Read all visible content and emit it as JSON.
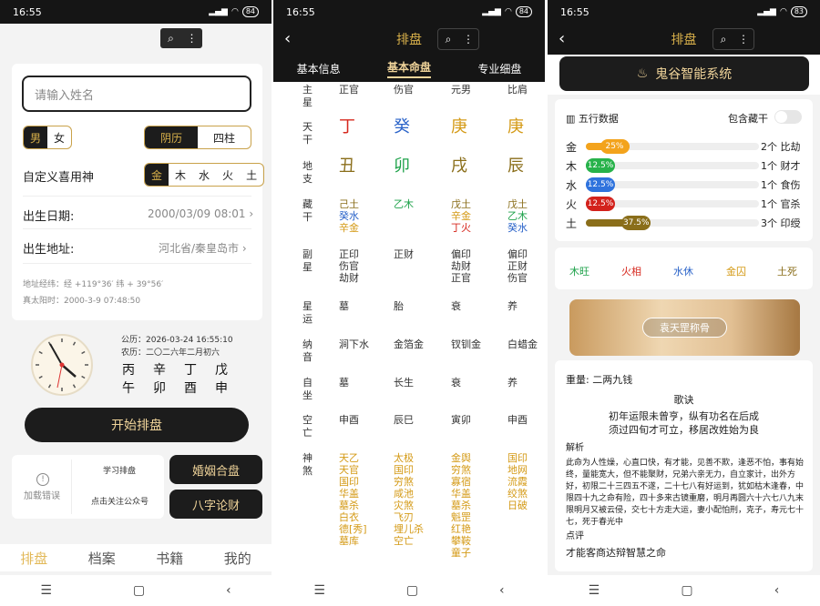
{
  "status": {
    "time": "16:55",
    "battery1": "84",
    "battery2": "84",
    "battery3": "83"
  },
  "p1": {
    "name_placeholder": "请输入姓名",
    "gender": [
      "男",
      "女"
    ],
    "calendar": [
      "阴历",
      "四柱"
    ],
    "xiyong_label": "自定义喜用神",
    "xiyong": [
      "金",
      "木",
      "水",
      "火",
      "土"
    ],
    "birth_date_label": "出生日期:",
    "birth_date": "2000/03/09 08:01",
    "birth_place_label": "出生地址:",
    "birth_place": "河北省/秦皇岛市",
    "coords": "地址经纬：经 +119°36′ 纬 + 39°56′",
    "solar_time": "真太阳时：2000-3-9 07:48:50",
    "gongli": "公历：2026-03-24 16:55:10",
    "nongli": "农历：二〇二六年二月初六",
    "bazi_top": [
      "丙",
      "辛",
      "丁",
      "戊"
    ],
    "bazi_bottom": [
      "午",
      "卯",
      "酉",
      "申"
    ],
    "start_btn": "开始排盘",
    "load_error": "加载错误",
    "learn": "学习排盘",
    "follow": "点击关注公众号",
    "marriage": "婚姻合盘",
    "bazi_talk": "八字论财",
    "nav": [
      "排盘",
      "档案",
      "书籍",
      "我的"
    ]
  },
  "p2": {
    "title": "排盘",
    "tabs": [
      "基本信息",
      "基本命盘",
      "专业细盘"
    ],
    "rows": [
      {
        "label": "主星",
        "cells": [
          [
            "正官"
          ],
          [
            "伤官"
          ],
          [
            "元男"
          ],
          [
            "比肩"
          ]
        ]
      },
      {
        "label": "天干",
        "cells": [
          [
            "丁"
          ],
          [
            "癸"
          ],
          [
            "庚"
          ],
          [
            "庚"
          ]
        ]
      },
      {
        "label": "地支",
        "cells": [
          [
            "丑"
          ],
          [
            "卯"
          ],
          [
            "戌"
          ],
          [
            "辰"
          ]
        ]
      },
      {
        "label": "藏干",
        "cells": [
          [
            "己土",
            "癸水",
            "辛金"
          ],
          [
            "乙木"
          ],
          [
            "戊土",
            "辛金",
            "丁火"
          ],
          [
            "戊土",
            "乙木",
            "癸水"
          ]
        ]
      },
      {
        "label": "副星",
        "cells": [
          [
            "正印",
            "伤官",
            "劫财"
          ],
          [
            "正财"
          ],
          [
            "偏印",
            "劫财",
            "正官"
          ],
          [
            "偏印",
            "正财",
            "伤官"
          ]
        ]
      },
      {
        "label": "星运",
        "cells": [
          [
            "墓"
          ],
          [
            "胎"
          ],
          [
            "衰"
          ],
          [
            "养"
          ]
        ]
      },
      {
        "label": "纳音",
        "cells": [
          [
            "涧下水"
          ],
          [
            "金箔金"
          ],
          [
            "钗钏金"
          ],
          [
            "白蜡金"
          ]
        ]
      },
      {
        "label": "自坐",
        "cells": [
          [
            "墓"
          ],
          [
            "长生"
          ],
          [
            "衰"
          ],
          [
            "养"
          ]
        ]
      },
      {
        "label": "空亡",
        "cells": [
          [
            "申酉"
          ],
          [
            "辰巳"
          ],
          [
            "寅卯"
          ],
          [
            "申酉"
          ]
        ]
      },
      {
        "label": "神煞",
        "cells": [
          [
            "天乙",
            "天官",
            "国印",
            "华盖",
            "墓杀",
            "白衣",
            "德[秀]",
            "墓库"
          ],
          [
            "太极",
            "国印",
            "穷煞",
            "咸池",
            "灾煞",
            "飞刃",
            "埋儿杀",
            "空亡"
          ],
          [
            "金舆",
            "穷煞",
            "寡宿",
            "华盖",
            "墓杀",
            "魁罡",
            "红艳",
            "攀鞍",
            "童子"
          ],
          [
            "国印",
            "地网",
            "流霞",
            "绞煞",
            "日破"
          ]
        ]
      }
    ]
  },
  "p3": {
    "title": "排盘",
    "banner": "鬼谷智能系统",
    "wuxing_title": "五行数据",
    "include_label": "包含藏干",
    "bars": [
      {
        "el": "金",
        "pct": 25,
        "pct_label": "25%",
        "count": "2个 比劫",
        "color": "#f3a31c"
      },
      {
        "el": "木",
        "pct": 12.5,
        "pct_label": "12.5%",
        "count": "1个 财才",
        "color": "#27b24a"
      },
      {
        "el": "水",
        "pct": 12.5,
        "pct_label": "12.5%",
        "count": "1个 食伤",
        "color": "#2f73dd"
      },
      {
        "el": "火",
        "pct": 12.5,
        "pct_label": "12.5%",
        "count": "1个 官杀",
        "color": "#d3221c"
      },
      {
        "el": "土",
        "pct": 37.5,
        "pct_label": "37.5%",
        "count": "3个 印绶",
        "color": "#8a6e1a"
      }
    ],
    "states": [
      {
        "t": "木旺",
        "c": "#1ea24a"
      },
      {
        "t": "火相",
        "c": "#d6281e"
      },
      {
        "t": "水休",
        "c": "#2a63c9"
      },
      {
        "t": "金囚",
        "c": "#d49a16"
      },
      {
        "t": "土死",
        "c": "#8a6e1a"
      }
    ],
    "photo_btn": "袁天罡称骨",
    "weight": "重量: 二两九钱",
    "poem_title": "歌诀",
    "poem1": "初年运限未曾亨，纵有功名在后成",
    "poem2": "须过四旬才可立，移居改姓始为良",
    "analysis_title": "解析",
    "analysis": "此命为人性燥，心直口快，有才能，见善不欺，逢恶不怕，事有始终，量能宽大，但不能聚财，兄弟六亲无力，自立家计，出外方好，初限二十三四五不遂，二十七八有好运到，犹如枯木逢春，中限四十九之命有险，四十多来古镜重磨，明月再圆六十六七八九末限明月又被云侵，交七十方走大运，妻小配怕刑，克子，寿元七十七，死于春光中",
    "review_title": "点评",
    "review": "才能客商达辩智慧之命"
  }
}
